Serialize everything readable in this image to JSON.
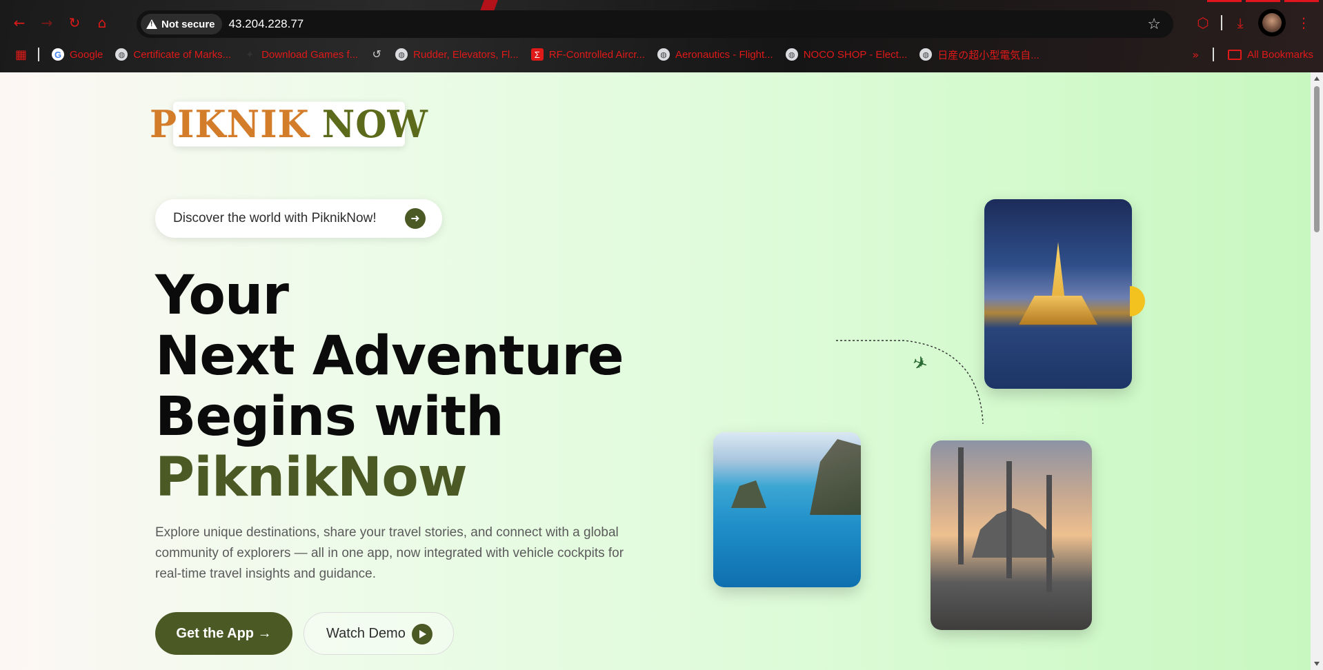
{
  "browser": {
    "security_label": "Not secure",
    "url": "43.204.228.77",
    "bookmarks": [
      {
        "label": "Google",
        "icon": "google-icon"
      },
      {
        "label": "Certificate of Marks...",
        "icon": "globe-icon"
      },
      {
        "label": "Download Games f...",
        "icon": "game-icon"
      },
      {
        "label": "",
        "icon": "history-icon"
      },
      {
        "label": "Rudder, Elevators, Fl...",
        "icon": "globe-icon"
      },
      {
        "label": "RF-Controlled Aircr...",
        "icon": "sigma-icon"
      },
      {
        "label": "Aeronautics - Flight...",
        "icon": "globe-icon"
      },
      {
        "label": "NOCO SHOP - Elect...",
        "icon": "globe-icon"
      },
      {
        "label": "日産の超小型電気自...",
        "icon": "globe-icon"
      }
    ],
    "all_bookmarks_label": "All Bookmarks",
    "accent_color": "#e01919"
  },
  "site": {
    "logo_part1": "PIKNIK",
    "logo_part2": "NOW",
    "tagline": "Discover the world with PiknikNow!",
    "headline": {
      "line1": "Your",
      "line2": "Next Adventure",
      "line3": "Begins with",
      "brand": "PiknikNow"
    },
    "description": "Explore unique destinations, share your travel stories, and connect with a global community of explorers — all in one app, now integrated with vehicle cockpits for real-time travel insights and guidance.",
    "cta_primary": "Get the App →",
    "cta_secondary": "Watch Demo",
    "brand_color": "#4b5a25",
    "logo_orange": "#d37c2a"
  }
}
